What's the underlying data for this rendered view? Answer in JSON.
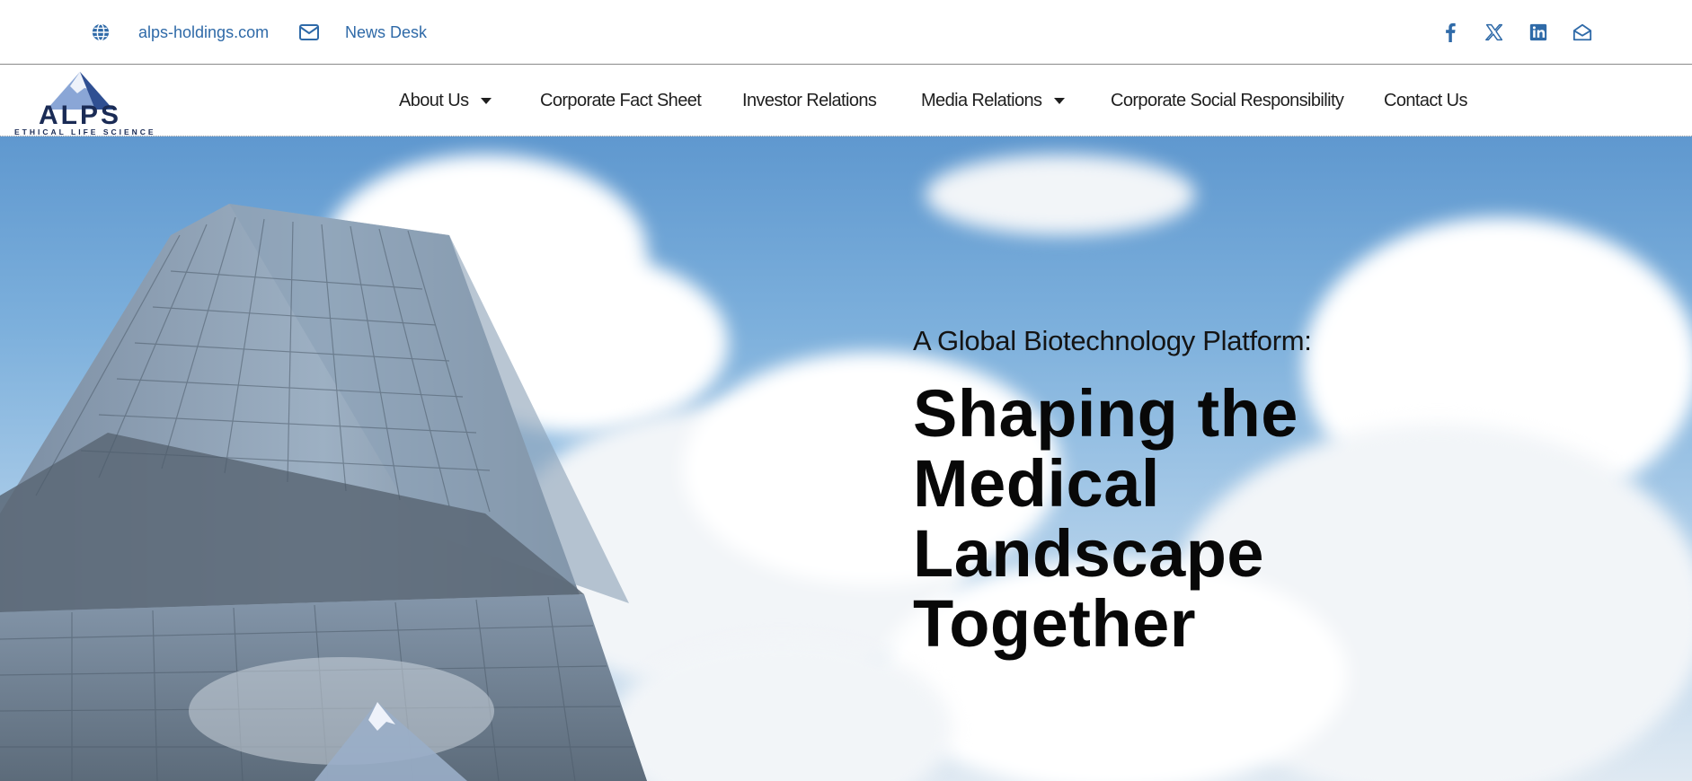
{
  "topbar": {
    "website_label": "alps-holdings.com",
    "newsdesk_label": "News Desk",
    "social_icons": [
      "facebook-icon",
      "x-icon",
      "linkedin-icon",
      "email-icon"
    ]
  },
  "logo": {
    "name": "ALPS",
    "tagline": "ETHICAL LIFE SCIENCE"
  },
  "nav": {
    "items": [
      {
        "label": "About Us",
        "has_dropdown": true
      },
      {
        "label": "Corporate Fact Sheet",
        "has_dropdown": false
      },
      {
        "label": "Investor Relations",
        "has_dropdown": false
      },
      {
        "label": "Media Relations",
        "has_dropdown": true
      },
      {
        "label": "Corporate Social Responsibility",
        "has_dropdown": false
      },
      {
        "label": "Contact Us",
        "has_dropdown": false
      }
    ]
  },
  "hero": {
    "subtitle": "A Global Biotechnology Platform:",
    "title_lines": [
      "Shaping the",
      "Medical",
      "Landscape",
      "Together"
    ]
  },
  "colors": {
    "link_blue": "#2f6aa8",
    "brand_navy": "#1a2b55",
    "nav_text": "#1f1f1f"
  }
}
